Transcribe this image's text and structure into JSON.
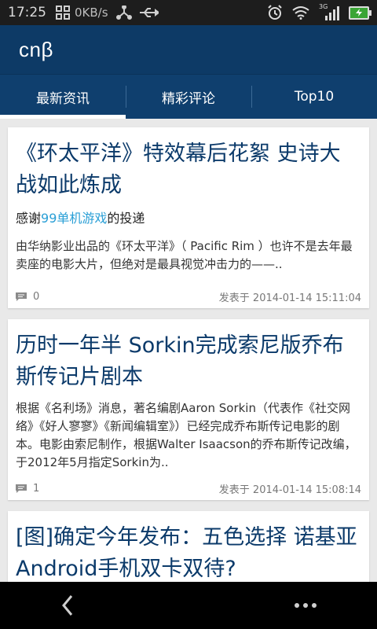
{
  "status": {
    "time": "17:25",
    "net_speed": "0KB/s",
    "signal_label": "3G"
  },
  "app": {
    "title": "cnβ"
  },
  "tabs": [
    {
      "label": "最新资讯",
      "active": true
    },
    {
      "label": "精彩评论",
      "active": false
    },
    {
      "label": "Top10",
      "active": false
    }
  ],
  "articles": [
    {
      "title": "《环太平洋》特效幕后花絮 史诗大战如此炼成",
      "thanks_prefix": "感谢",
      "thanks_link": "99单机游戏",
      "thanks_suffix": "的投递",
      "excerpt": "由华纳影业出品的《环太平洋》（ Pacific Rim ）也许不是去年最卖座的电影大片，但绝对是最具视觉冲击力的——..",
      "comments": "0",
      "date": "发表于 2014-01-14 15:11:04"
    },
    {
      "title": "历时一年半 Sorkin完成索尼版乔布斯传记片剧本",
      "excerpt": "根据《名利场》消息，著名编剧Aaron Sorkin（代表作《社交网络》《好人寥寥》《新闻编辑室》）已经完成乔布斯传记电影的剧本。电影由索尼制作，根据Walter Isaacson的乔布斯传记改编，于2012年5月指定Sorkin为..",
      "comments": "1",
      "date": "发表于 2014-01-14 15:08:14"
    },
    {
      "title": "[图]确定今年发布：五色选择 诺基亚Android手机双卡双待?"
    }
  ],
  "colors": {
    "appbar": "#0d3a66",
    "tabs": "#0f3f6e",
    "title": "#0b3a6a",
    "link": "#2a9fd6"
  }
}
